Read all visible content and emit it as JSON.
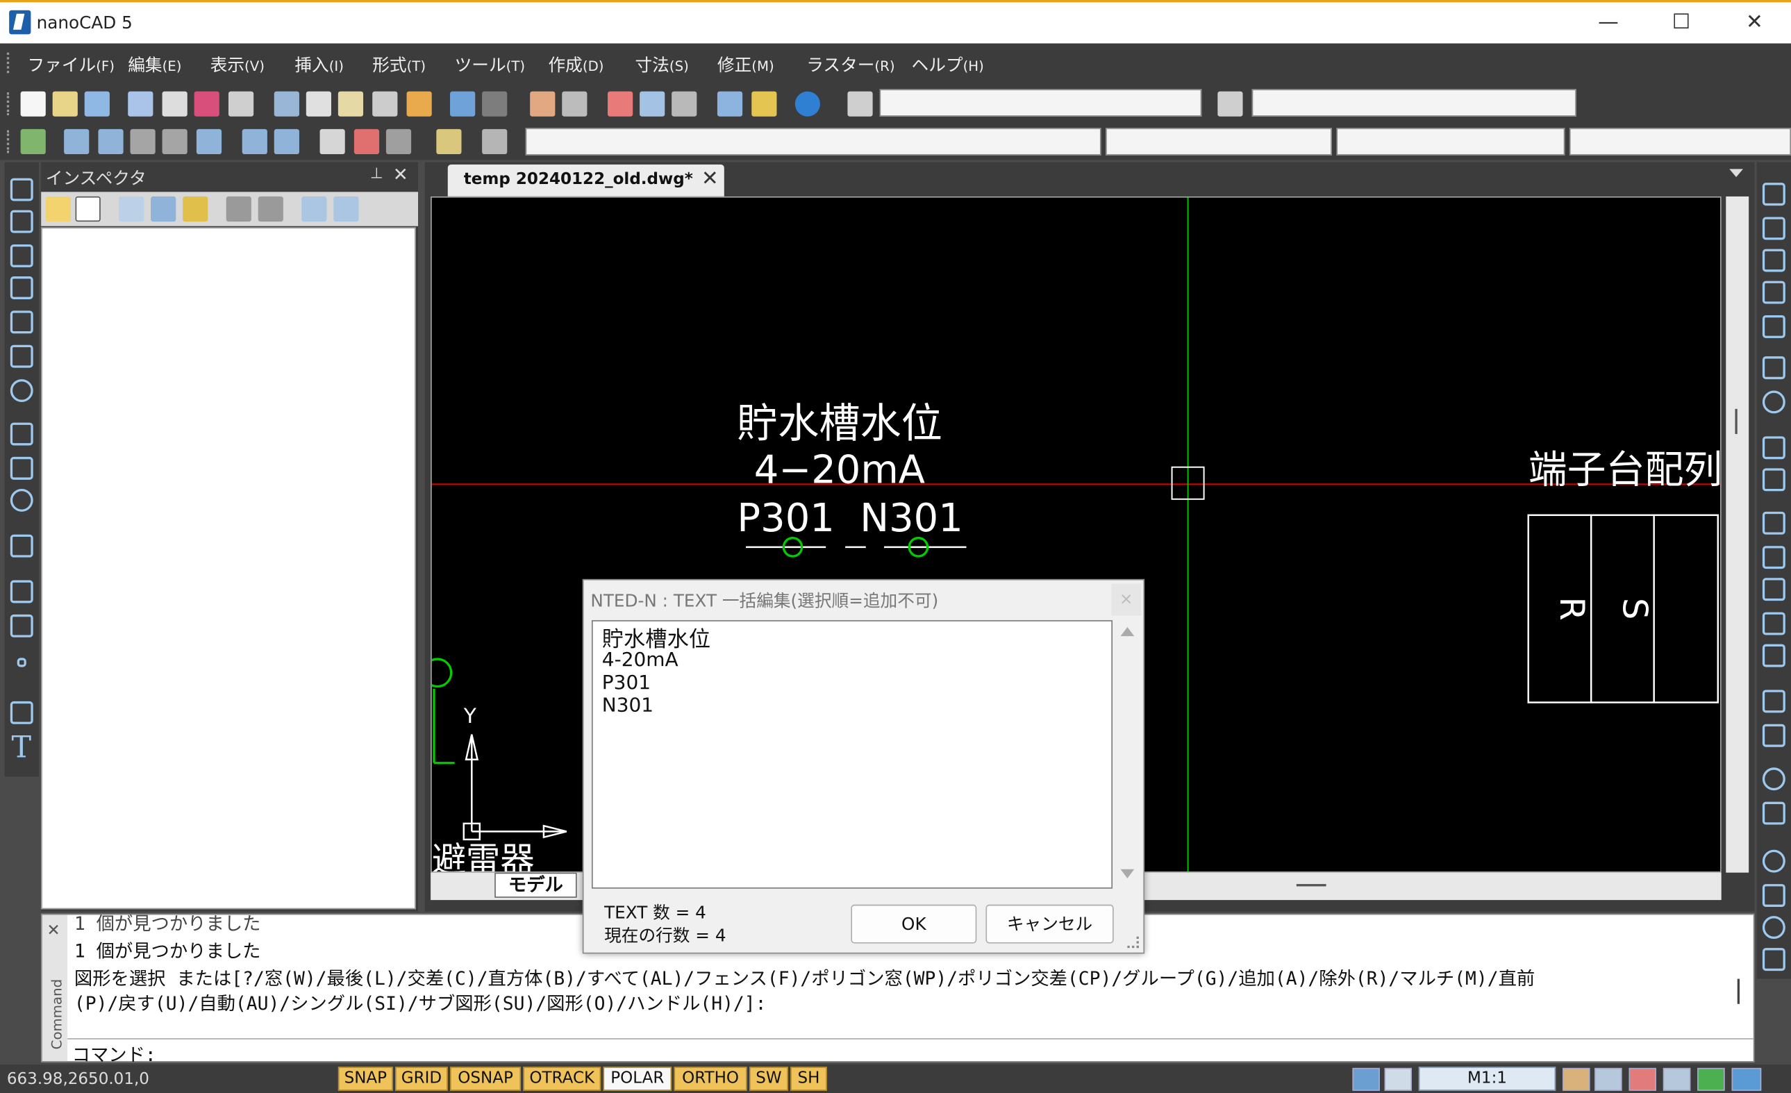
{
  "window": {
    "title": "nanoCAD 5",
    "minimize": "—",
    "maximize": "☐",
    "close": "✕"
  },
  "menu": [
    {
      "label": "ファイル",
      "key": "(F)"
    },
    {
      "label": "編集",
      "key": "(E)"
    },
    {
      "label": "表示",
      "key": "(V)"
    },
    {
      "label": "挿入",
      "key": "(I)"
    },
    {
      "label": "形式",
      "key": "(T)"
    },
    {
      "label": "ツール",
      "key": "(T)"
    },
    {
      "label": "作成",
      "key": "(D)"
    },
    {
      "label": "寸法",
      "key": "(S)"
    },
    {
      "label": "修正",
      "key": "(M)"
    },
    {
      "label": "ラスター",
      "key": "(R)"
    },
    {
      "label": "ヘルプ",
      "key": "(H)"
    }
  ],
  "inspector": {
    "title": "インスペクタ",
    "pin": "จ",
    "close": "✕"
  },
  "document": {
    "tab_label": "temp 20240122_old.dwg*",
    "tab_close": "✕",
    "model_tab": "モデル"
  },
  "drawing": {
    "label1": "貯水槽水位",
    "label2": "4−20mA",
    "label3": "P301",
    "label4": "N301",
    "label5": "端子台配列",
    "terminal_r": "R",
    "terminal_s": "S",
    "label6": "避雷器",
    "axis_y": "Y"
  },
  "command": {
    "side_label": "Command",
    "line1": "1 個が見つかりました",
    "line2": "1 個が見つかりました",
    "line3": "図形を選択 または[?/窓(W)/最後(L)/交差(C)/直方体(B)/すべて(AL)/フェンス(F)/ポリゴン窓(WP)/ポリゴン交差(CP)/グループ(G)/追加(A)/除外(R)/マルチ(M)/直前",
    "line4": "(P)/戻す(U)/自動(AU)/シングル(SI)/サブ図形(SU)/図形(O)/ハンドル(H)/]:",
    "prompt": "コマンド:"
  },
  "status": {
    "coords": "663.98,2650.01,0",
    "buttons": [
      "SNAP",
      "GRID",
      "OSNAP",
      "OTRACK",
      "POLAR",
      "ORTHO",
      "SW",
      "SH"
    ],
    "scale": "M1:1"
  },
  "dialog": {
    "title": "NTED-N : TEXT 一括編集(選択順=追加不可)",
    "close": "×",
    "lines": [
      "貯水槽水位",
      "4-20mA",
      "P301",
      "N301"
    ],
    "info_count": "TEXT 数 = 4",
    "info_lines": "現在の行数 = 4",
    "ok": "OK",
    "cancel": "キャンセル"
  },
  "colors": {
    "canvas_bg": "#000000",
    "crosshair_h": "#e00000",
    "crosshair_v": "#00c000",
    "drawing_text": "#ffffff",
    "accent_green": "#00cc00"
  }
}
